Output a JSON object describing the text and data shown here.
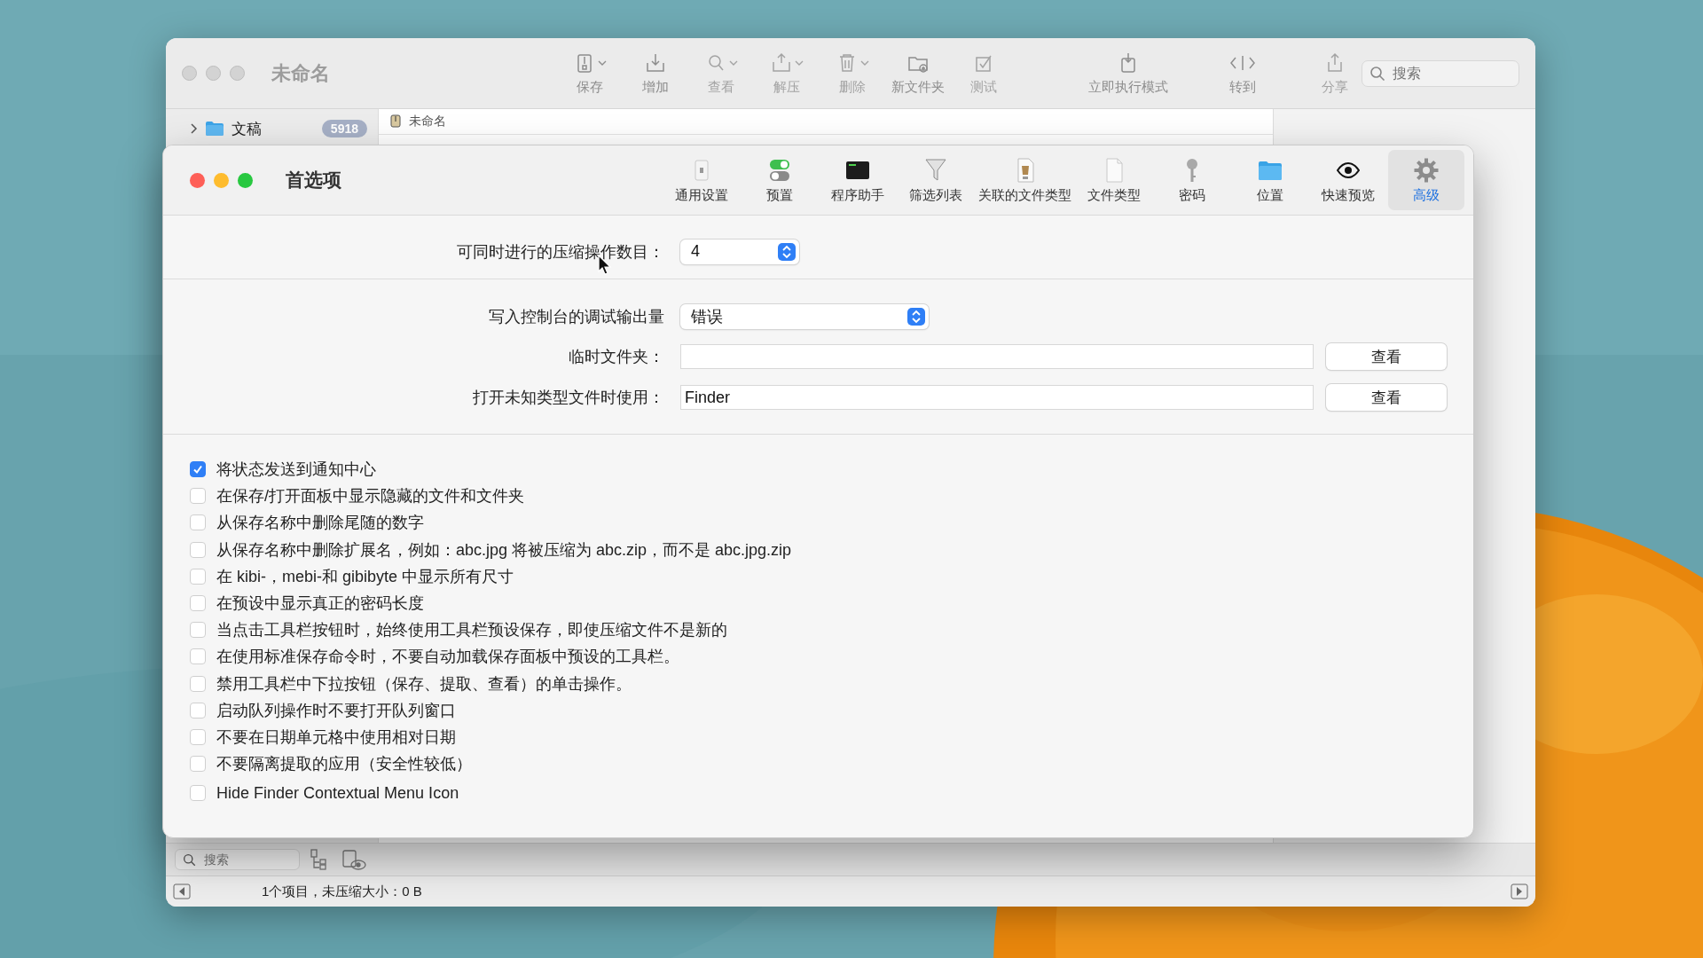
{
  "background_window": {
    "title": "未命名",
    "toolbar": [
      {
        "label": "保存",
        "disabled": false,
        "has_menu": true
      },
      {
        "label": "增加",
        "disabled": false,
        "has_menu": false
      },
      {
        "label": "查看",
        "disabled": true,
        "has_menu": true
      },
      {
        "label": "解压",
        "disabled": true,
        "has_menu": true
      },
      {
        "label": "删除",
        "disabled": true,
        "has_menu": true
      },
      {
        "label": "新文件夹",
        "disabled": false,
        "has_menu": false
      },
      {
        "label": "测试",
        "disabled": true,
        "has_menu": false
      },
      {
        "label": "立即执行模式",
        "disabled": false,
        "has_menu": false
      },
      {
        "label": "转到",
        "disabled": false,
        "has_menu": false
      },
      {
        "label": "分享",
        "disabled": true,
        "has_menu": false
      }
    ],
    "search": {
      "placeholder": "搜索"
    },
    "sidebar": {
      "items": [
        {
          "label": "文稿",
          "badge": "5918",
          "expanded": false
        }
      ]
    },
    "path_bar": "未命名",
    "bottom_search": {
      "placeholder": "搜索"
    },
    "status_bar": "1个项目，未压缩大小：0 B"
  },
  "preferences": {
    "title": "首选项",
    "tabs": [
      {
        "label": "通用设置",
        "selected": false
      },
      {
        "label": "预置",
        "selected": false
      },
      {
        "label": "程序助手",
        "selected": false
      },
      {
        "label": "筛选列表",
        "selected": false
      },
      {
        "label": "关联的文件类型",
        "selected": false
      },
      {
        "label": "文件类型",
        "selected": false
      },
      {
        "label": "密码",
        "selected": false
      },
      {
        "label": "位置",
        "selected": false
      },
      {
        "label": "快速预览",
        "selected": false
      },
      {
        "label": "高级",
        "selected": true
      }
    ],
    "concurrent_operations": {
      "label": "可同时进行的压缩操作数目：",
      "value": "4"
    },
    "debug_output": {
      "label": "写入控制台的调试输出量",
      "value": "错误"
    },
    "temp_folder": {
      "label": "临时文件夹：",
      "button": "查看"
    },
    "open_unknown_with": {
      "label": "打开未知类型文件时使用：",
      "value": "Finder",
      "button": "查看"
    },
    "options": [
      {
        "label": "将状态发送到通知中心",
        "checked": true
      },
      {
        "label": "在保存/打开面板中显示隐藏的文件和文件夹",
        "checked": false
      },
      {
        "label": "从保存名称中删除尾随的数字",
        "checked": false
      },
      {
        "label": "从保存名称中删除扩展名，例如：abc.jpg 将被压缩为 abc.zip，而不是 abc.jpg.zip",
        "checked": false
      },
      {
        "label": "在 kibi-，mebi-和 gibibyte 中显示所有尺寸",
        "checked": false
      },
      {
        "label": "在预设中显示真正的密码长度",
        "checked": false
      },
      {
        "label": "当点击工具栏按钮时，始终使用工具栏预设保存，即使压缩文件不是新的",
        "checked": false
      },
      {
        "label": "在使用标准保存命令时，不要自动加载保存面板中预设的工具栏。",
        "checked": false
      },
      {
        "label": "禁用工具栏中下拉按钮（保存、提取、查看）的单击操作。",
        "checked": false
      },
      {
        "label": "启动队列操作时不要打开队列窗口",
        "checked": false
      },
      {
        "label": "不要在日期单元格中使用相对日期",
        "checked": false
      },
      {
        "label": "不要隔离提取的应用（安全性较低）",
        "checked": false
      },
      {
        "label": "Hide Finder Contextual Menu Icon",
        "checked": false
      }
    ]
  }
}
